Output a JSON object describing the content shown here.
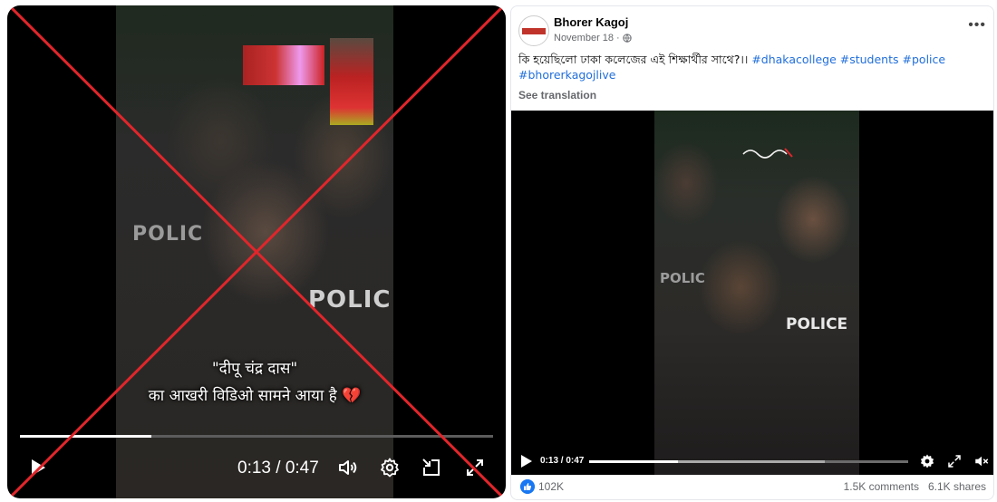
{
  "left_player": {
    "caption_line1": "\"दीपू चंद्र दास\"",
    "caption_line2": "का आखरी विडिओ सामने आया है 💔",
    "overlay_text": [
      "POLIC",
      "POLIC"
    ],
    "time_display": "0:13 / 0:47",
    "progress_fraction": 0.277,
    "icons": [
      "play-icon",
      "volume-icon",
      "settings-gear-icon",
      "picture-in-picture-icon",
      "fullscreen-icon"
    ],
    "cross_color": "#e0262b"
  },
  "post": {
    "page_name": "Bhorer Kagoj",
    "date": "November 18",
    "meta_separator": "·",
    "text_bengali": "কি হয়েছিলো ঢাকা কলেজের এই শিক্ষার্থীর সাথে?।।",
    "hashtags": [
      "#dhakacollege",
      "#students",
      "#police",
      "#bhorerkagojlive"
    ],
    "see_translation": "See translation",
    "video": {
      "overlay_text": [
        "POLIC",
        "POLICE"
      ],
      "time_display": "0:13 / 0:47",
      "progress_fraction": 0.277,
      "buffered_fraction": 0.74,
      "icons": [
        "play-icon",
        "settings-gear-icon",
        "expand-icon",
        "muted-volume-icon"
      ]
    },
    "reactions_count": "102K",
    "comments": "1.5K comments",
    "shares": "6.1K shares",
    "accent_color": "#1877f2",
    "hashtag_color": "#216fdb"
  }
}
